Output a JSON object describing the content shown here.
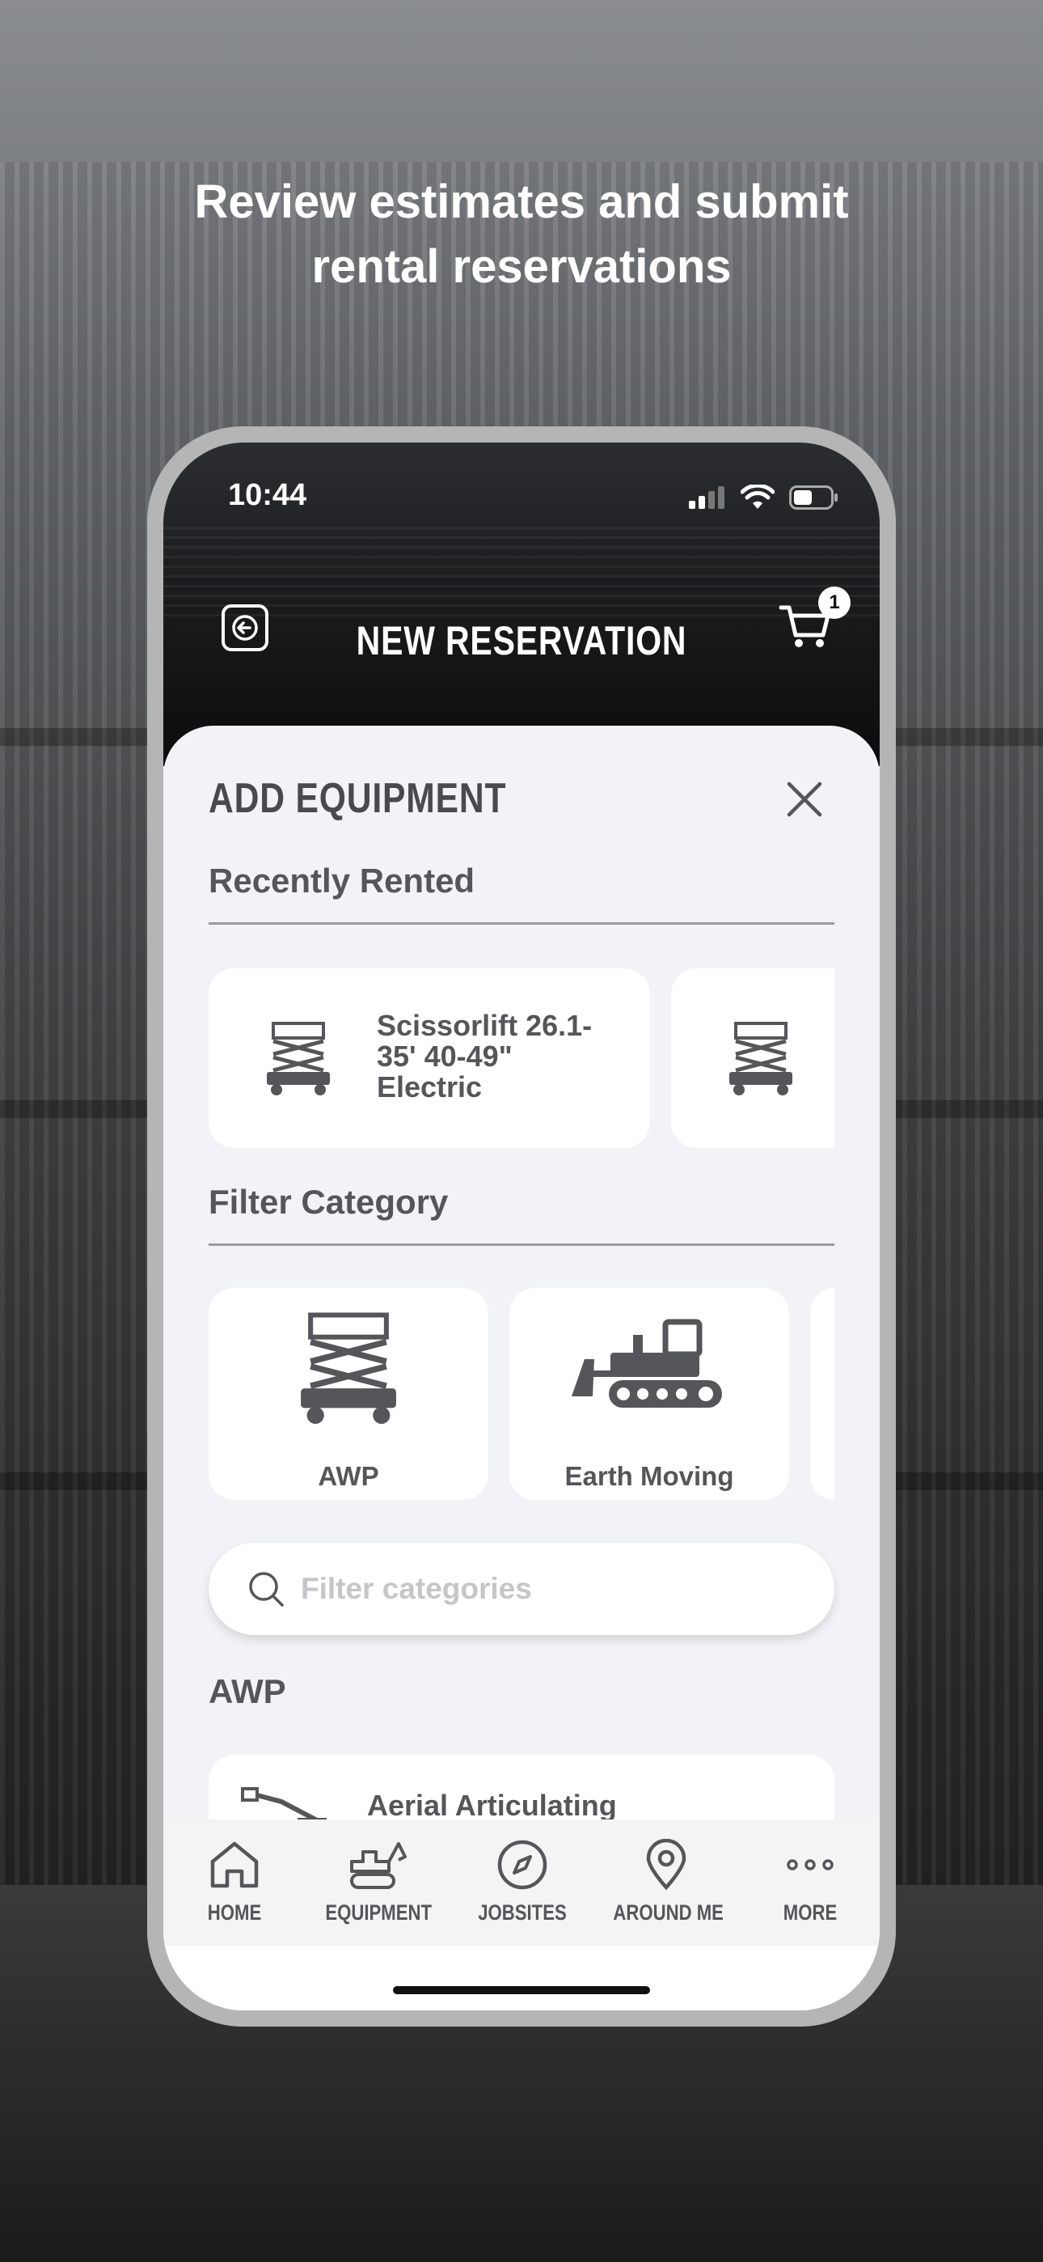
{
  "headline": {
    "line1": "Review estimates and submit",
    "line2": "rental reservations"
  },
  "status_bar": {
    "time": "10:44",
    "icons": [
      "cellular-signal-icon",
      "wifi-icon",
      "battery-icon"
    ]
  },
  "nav": {
    "title": "NEW RESERVATION",
    "cart_count": "1"
  },
  "sheet": {
    "title": "ADD EQUIPMENT",
    "recently_rented": {
      "label": "Recently Rented",
      "items": [
        {
          "name": "Scissorlift 26.1-35' 40-49\" Electric",
          "icon": "scissor-lift-icon"
        },
        {
          "name": "",
          "icon": "scissor-lift-icon"
        }
      ]
    },
    "filter_category": {
      "label": "Filter Category",
      "items": [
        {
          "label": "AWP",
          "icon": "scissor-lift-icon"
        },
        {
          "label": "Earth Moving",
          "icon": "bulldozer-icon"
        }
      ]
    },
    "search": {
      "placeholder": "Filter categories",
      "value": ""
    },
    "awp_section": {
      "heading": "AWP",
      "items": [
        {
          "name": "Aerial Articulating",
          "icon": "articulating-boom-icon"
        }
      ]
    }
  },
  "tabbar": {
    "items": [
      {
        "label": "HOME",
        "icon": "home-icon"
      },
      {
        "label": "EQUIPMENT",
        "icon": "excavator-icon"
      },
      {
        "label": "JOBSITES",
        "icon": "compass-icon"
      },
      {
        "label": "AROUND ME",
        "icon": "map-pin-icon"
      },
      {
        "label": "MORE",
        "icon": "more-dots-icon"
      }
    ]
  },
  "colors": {
    "text_primary": "#55565a",
    "sheet_background": "#f2f3f6",
    "header_background": "#0b0c0d",
    "placeholder": "#c5c6c9"
  }
}
